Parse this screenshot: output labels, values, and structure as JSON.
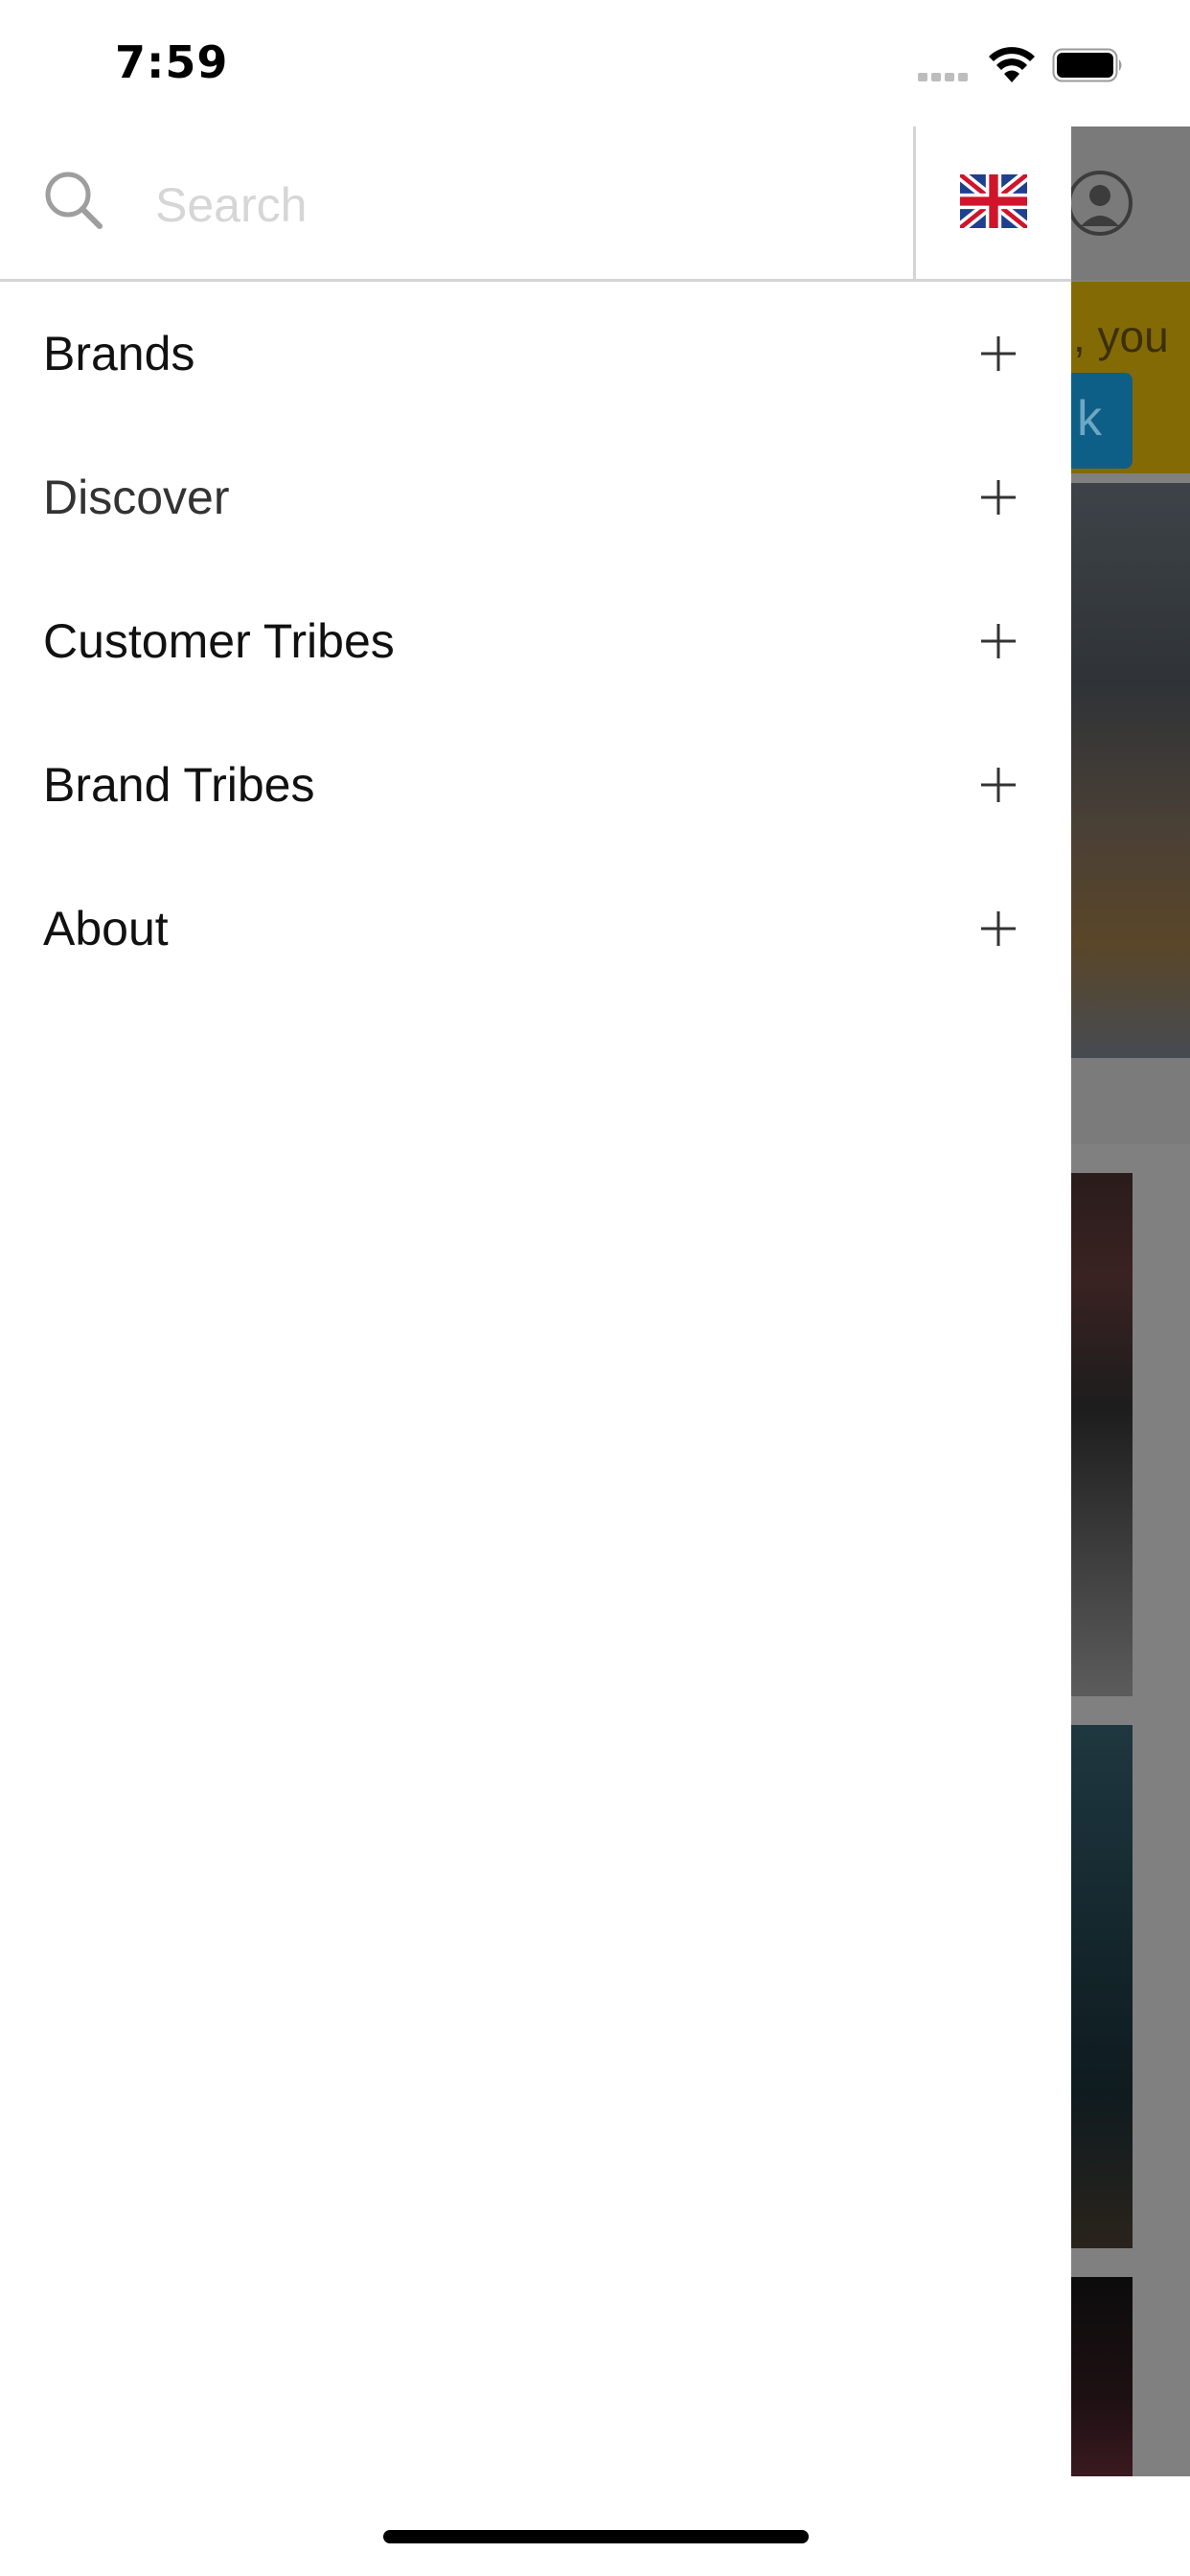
{
  "status_bar": {
    "time": "7:59"
  },
  "search": {
    "placeholder": "Search"
  },
  "language": {
    "flag": "united-kingdom-flag"
  },
  "menu": {
    "items": [
      {
        "label": "Brands",
        "icon": "plus-icon"
      },
      {
        "label": "Discover",
        "icon": "plus-icon"
      },
      {
        "label": "Customer Tribes",
        "icon": "plus-icon"
      },
      {
        "label": "Brand Tribes",
        "icon": "plus-icon"
      },
      {
        "label": "About",
        "icon": "plus-icon"
      }
    ]
  },
  "background": {
    "banner_text": ", you",
    "banner_button_text": "k"
  },
  "colors": {
    "drawer_background": "#ffffff",
    "divider": "#d4d4d4",
    "overlay_gray": "#808080",
    "banner_yellow": "#846a05",
    "banner_button_blue": "#0e5f87"
  }
}
